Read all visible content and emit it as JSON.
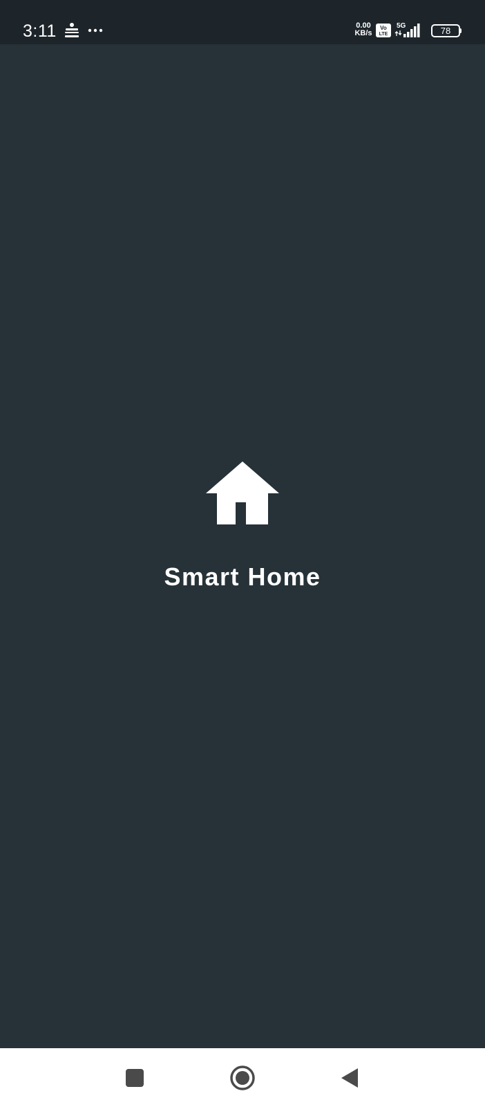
{
  "status_bar": {
    "time": "3:11",
    "net_speed_value": "0.00",
    "net_speed_unit": "KB/s",
    "volte_top": "Vo",
    "volte_bottom": "LTE",
    "network_type": "5G",
    "battery_level": "78",
    "icons": [
      "news-app-icon",
      "more-dots-icon",
      "volte-icon",
      "signal-icon",
      "battery-icon"
    ]
  },
  "splash": {
    "logo_icon": "home-icon",
    "title": "Smart Home"
  },
  "nav_bar": {
    "buttons": [
      {
        "name": "recents",
        "icon": "square-icon"
      },
      {
        "name": "home",
        "icon": "circle-icon"
      },
      {
        "name": "back",
        "icon": "triangle-back-icon"
      }
    ]
  },
  "colors": {
    "background": "#263238",
    "status_bar": "#1d252b",
    "text": "#ffffff",
    "nav_bar": "#ffffff",
    "nav_icons": "#4a4a4a"
  }
}
